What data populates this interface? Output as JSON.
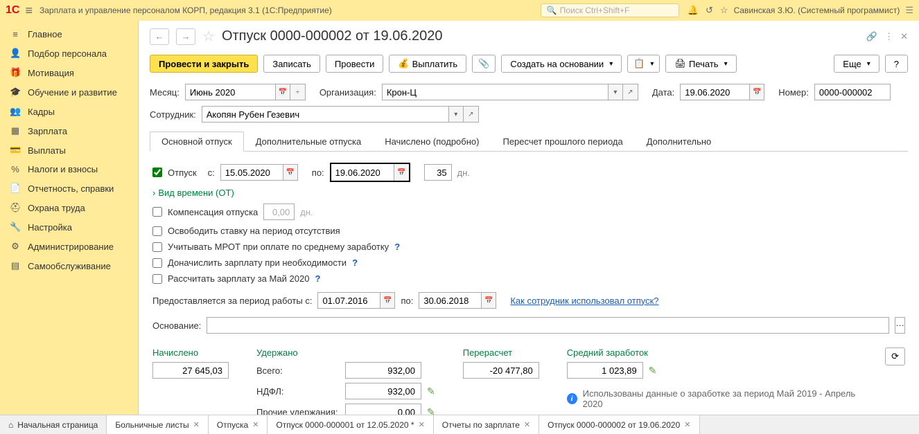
{
  "top": {
    "title": "Зарплата и управление персоналом КОРП, редакция 3.1  (1С:Предприятие)",
    "search_placeholder": "Поиск Ctrl+Shift+F",
    "user": "Савинская З.Ю. (Системный программист)"
  },
  "sidebar": [
    {
      "icon": "≡",
      "label": "Главное"
    },
    {
      "icon": "👤",
      "label": "Подбор персонала"
    },
    {
      "icon": "🎁",
      "label": "Мотивация"
    },
    {
      "icon": "🎓",
      "label": "Обучение и развитие"
    },
    {
      "icon": "👥",
      "label": "Кадры"
    },
    {
      "icon": "▦",
      "label": "Зарплата"
    },
    {
      "icon": "💳",
      "label": "Выплаты"
    },
    {
      "icon": "%",
      "label": "Налоги и взносы"
    },
    {
      "icon": "📄",
      "label": "Отчетность, справки"
    },
    {
      "icon": "⛑",
      "label": "Охрана труда"
    },
    {
      "icon": "🔧",
      "label": "Настройка"
    },
    {
      "icon": "⚙",
      "label": "Администрирование"
    },
    {
      "icon": "▤",
      "label": "Самообслуживание"
    }
  ],
  "doc": {
    "title": "Отпуск 0000-000002 от 19.06.2020"
  },
  "toolbar": {
    "post_close": "Провести и закрыть",
    "save": "Записать",
    "post": "Провести",
    "pay": "Выплатить",
    "create_based": "Создать на основании",
    "print": "Печать",
    "more": "Еще",
    "help": "?"
  },
  "header_form": {
    "month_label": "Месяц:",
    "month_value": "Июнь 2020",
    "org_label": "Организация:",
    "org_value": "Крон-Ц",
    "date_label": "Дата:",
    "date_value": "19.06.2020",
    "number_label": "Номер:",
    "number_value": "0000-000002",
    "employee_label": "Сотрудник:",
    "employee_value": "Акопян Рубен Гезевич"
  },
  "tabs": [
    "Основной отпуск",
    "Дополнительные отпуска",
    "Начислено (подробно)",
    "Пересчет прошлого периода",
    "Дополнительно"
  ],
  "vacation": {
    "check_label": "Отпуск",
    "from_label": "с:",
    "from_value": "15.05.2020",
    "to_label": "по:",
    "to_value": "19.06.2020",
    "days_value": "35",
    "days_label": "дн.",
    "time_type_link": "Вид времени (ОТ)",
    "comp_label": "Компенсация отпуска",
    "comp_value": "0,00",
    "comp_unit": "дн.",
    "release_label": "Освободить ставку на период отсутствия",
    "mrot_label": "Учитывать МРОТ при оплате по среднему заработку",
    "accrue_salary_label": "Доначислить зарплату при необходимости",
    "recalc_label": "Рассчитать зарплату за Май 2020",
    "period_label": "Предоставляется за период работы с:",
    "period_from": "01.07.2016",
    "period_to_label": "по:",
    "period_to": "30.06.2018",
    "usage_link": "Как сотрудник использовал отпуск?",
    "basis_label": "Основание:"
  },
  "summary": {
    "accrued_label": "Начислено",
    "accrued_value": "27 645,03",
    "withheld_label": "Удержано",
    "total_label": "Всего:",
    "total_value": "932,00",
    "ndfl_label": "НДФЛ:",
    "ndfl_value": "932,00",
    "other_label": "Прочие удержания:",
    "other_value": "0,00",
    "recalc_label": "Перерасчет",
    "recalc_value": "-20 477,80",
    "avg_label": "Средний заработок",
    "avg_value": "1 023,89",
    "info_text": "Использованы данные о заработке за период Май 2019 - Апрель 2020"
  },
  "bottom_tabs": [
    {
      "label": "Начальная страница",
      "home": true
    },
    {
      "label": "Больничные листы",
      "close": true
    },
    {
      "label": "Отпуска",
      "close": true
    },
    {
      "label": "Отпуск 0000-000001 от 12.05.2020 *",
      "close": true
    },
    {
      "label": "Отчеты по зарплате",
      "close": true
    },
    {
      "label": "Отпуск 0000-000002 от 19.06.2020",
      "close": true,
      "active": true
    }
  ]
}
